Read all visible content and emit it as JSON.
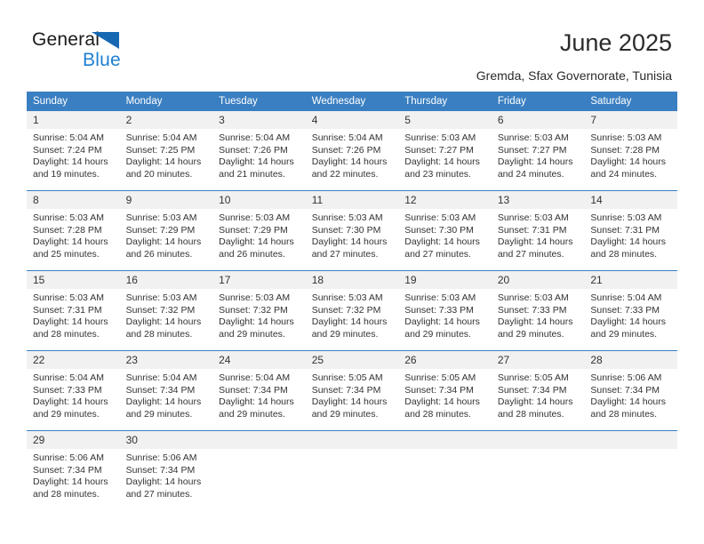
{
  "brand": {
    "name_part1": "General",
    "name_part2": "Blue",
    "triangle_color": "#1668b3",
    "blue_color": "#1b7fd4"
  },
  "header": {
    "title": "June 2025",
    "subtitle": "Gremda, Sfax Governorate, Tunisia"
  },
  "theme": {
    "header_bg": "#3a7fc1",
    "daynum_bg": "#f1f1f1",
    "grid_line": "#3a7fc1",
    "text": "#333333"
  },
  "calendar": {
    "weekday_headers": [
      "Sunday",
      "Monday",
      "Tuesday",
      "Wednesday",
      "Thursday",
      "Friday",
      "Saturday"
    ],
    "weeks": [
      [
        {
          "day": "1",
          "sunrise": "Sunrise: 5:04 AM",
          "sunset": "Sunset: 7:24 PM",
          "daylight1": "Daylight: 14 hours",
          "daylight2": "and 19 minutes."
        },
        {
          "day": "2",
          "sunrise": "Sunrise: 5:04 AM",
          "sunset": "Sunset: 7:25 PM",
          "daylight1": "Daylight: 14 hours",
          "daylight2": "and 20 minutes."
        },
        {
          "day": "3",
          "sunrise": "Sunrise: 5:04 AM",
          "sunset": "Sunset: 7:26 PM",
          "daylight1": "Daylight: 14 hours",
          "daylight2": "and 21 minutes."
        },
        {
          "day": "4",
          "sunrise": "Sunrise: 5:04 AM",
          "sunset": "Sunset: 7:26 PM",
          "daylight1": "Daylight: 14 hours",
          "daylight2": "and 22 minutes."
        },
        {
          "day": "5",
          "sunrise": "Sunrise: 5:03 AM",
          "sunset": "Sunset: 7:27 PM",
          "daylight1": "Daylight: 14 hours",
          "daylight2": "and 23 minutes."
        },
        {
          "day": "6",
          "sunrise": "Sunrise: 5:03 AM",
          "sunset": "Sunset: 7:27 PM",
          "daylight1": "Daylight: 14 hours",
          "daylight2": "and 24 minutes."
        },
        {
          "day": "7",
          "sunrise": "Sunrise: 5:03 AM",
          "sunset": "Sunset: 7:28 PM",
          "daylight1": "Daylight: 14 hours",
          "daylight2": "and 24 minutes."
        }
      ],
      [
        {
          "day": "8",
          "sunrise": "Sunrise: 5:03 AM",
          "sunset": "Sunset: 7:28 PM",
          "daylight1": "Daylight: 14 hours",
          "daylight2": "and 25 minutes."
        },
        {
          "day": "9",
          "sunrise": "Sunrise: 5:03 AM",
          "sunset": "Sunset: 7:29 PM",
          "daylight1": "Daylight: 14 hours",
          "daylight2": "and 26 minutes."
        },
        {
          "day": "10",
          "sunrise": "Sunrise: 5:03 AM",
          "sunset": "Sunset: 7:29 PM",
          "daylight1": "Daylight: 14 hours",
          "daylight2": "and 26 minutes."
        },
        {
          "day": "11",
          "sunrise": "Sunrise: 5:03 AM",
          "sunset": "Sunset: 7:30 PM",
          "daylight1": "Daylight: 14 hours",
          "daylight2": "and 27 minutes."
        },
        {
          "day": "12",
          "sunrise": "Sunrise: 5:03 AM",
          "sunset": "Sunset: 7:30 PM",
          "daylight1": "Daylight: 14 hours",
          "daylight2": "and 27 minutes."
        },
        {
          "day": "13",
          "sunrise": "Sunrise: 5:03 AM",
          "sunset": "Sunset: 7:31 PM",
          "daylight1": "Daylight: 14 hours",
          "daylight2": "and 27 minutes."
        },
        {
          "day": "14",
          "sunrise": "Sunrise: 5:03 AM",
          "sunset": "Sunset: 7:31 PM",
          "daylight1": "Daylight: 14 hours",
          "daylight2": "and 28 minutes."
        }
      ],
      [
        {
          "day": "15",
          "sunrise": "Sunrise: 5:03 AM",
          "sunset": "Sunset: 7:31 PM",
          "daylight1": "Daylight: 14 hours",
          "daylight2": "and 28 minutes."
        },
        {
          "day": "16",
          "sunrise": "Sunrise: 5:03 AM",
          "sunset": "Sunset: 7:32 PM",
          "daylight1": "Daylight: 14 hours",
          "daylight2": "and 28 minutes."
        },
        {
          "day": "17",
          "sunrise": "Sunrise: 5:03 AM",
          "sunset": "Sunset: 7:32 PM",
          "daylight1": "Daylight: 14 hours",
          "daylight2": "and 29 minutes."
        },
        {
          "day": "18",
          "sunrise": "Sunrise: 5:03 AM",
          "sunset": "Sunset: 7:32 PM",
          "daylight1": "Daylight: 14 hours",
          "daylight2": "and 29 minutes."
        },
        {
          "day": "19",
          "sunrise": "Sunrise: 5:03 AM",
          "sunset": "Sunset: 7:33 PM",
          "daylight1": "Daylight: 14 hours",
          "daylight2": "and 29 minutes."
        },
        {
          "day": "20",
          "sunrise": "Sunrise: 5:03 AM",
          "sunset": "Sunset: 7:33 PM",
          "daylight1": "Daylight: 14 hours",
          "daylight2": "and 29 minutes."
        },
        {
          "day": "21",
          "sunrise": "Sunrise: 5:04 AM",
          "sunset": "Sunset: 7:33 PM",
          "daylight1": "Daylight: 14 hours",
          "daylight2": "and 29 minutes."
        }
      ],
      [
        {
          "day": "22",
          "sunrise": "Sunrise: 5:04 AM",
          "sunset": "Sunset: 7:33 PM",
          "daylight1": "Daylight: 14 hours",
          "daylight2": "and 29 minutes."
        },
        {
          "day": "23",
          "sunrise": "Sunrise: 5:04 AM",
          "sunset": "Sunset: 7:34 PM",
          "daylight1": "Daylight: 14 hours",
          "daylight2": "and 29 minutes."
        },
        {
          "day": "24",
          "sunrise": "Sunrise: 5:04 AM",
          "sunset": "Sunset: 7:34 PM",
          "daylight1": "Daylight: 14 hours",
          "daylight2": "and 29 minutes."
        },
        {
          "day": "25",
          "sunrise": "Sunrise: 5:05 AM",
          "sunset": "Sunset: 7:34 PM",
          "daylight1": "Daylight: 14 hours",
          "daylight2": "and 29 minutes."
        },
        {
          "day": "26",
          "sunrise": "Sunrise: 5:05 AM",
          "sunset": "Sunset: 7:34 PM",
          "daylight1": "Daylight: 14 hours",
          "daylight2": "and 28 minutes."
        },
        {
          "day": "27",
          "sunrise": "Sunrise: 5:05 AM",
          "sunset": "Sunset: 7:34 PM",
          "daylight1": "Daylight: 14 hours",
          "daylight2": "and 28 minutes."
        },
        {
          "day": "28",
          "sunrise": "Sunrise: 5:06 AM",
          "sunset": "Sunset: 7:34 PM",
          "daylight1": "Daylight: 14 hours",
          "daylight2": "and 28 minutes."
        }
      ],
      [
        {
          "day": "29",
          "sunrise": "Sunrise: 5:06 AM",
          "sunset": "Sunset: 7:34 PM",
          "daylight1": "Daylight: 14 hours",
          "daylight2": "and 28 minutes."
        },
        {
          "day": "30",
          "sunrise": "Sunrise: 5:06 AM",
          "sunset": "Sunset: 7:34 PM",
          "daylight1": "Daylight: 14 hours",
          "daylight2": "and 27 minutes."
        },
        {
          "day": "",
          "sunrise": "",
          "sunset": "",
          "daylight1": "",
          "daylight2": ""
        },
        {
          "day": "",
          "sunrise": "",
          "sunset": "",
          "daylight1": "",
          "daylight2": ""
        },
        {
          "day": "",
          "sunrise": "",
          "sunset": "",
          "daylight1": "",
          "daylight2": ""
        },
        {
          "day": "",
          "sunrise": "",
          "sunset": "",
          "daylight1": "",
          "daylight2": ""
        },
        {
          "day": "",
          "sunrise": "",
          "sunset": "",
          "daylight1": "",
          "daylight2": ""
        }
      ]
    ]
  }
}
